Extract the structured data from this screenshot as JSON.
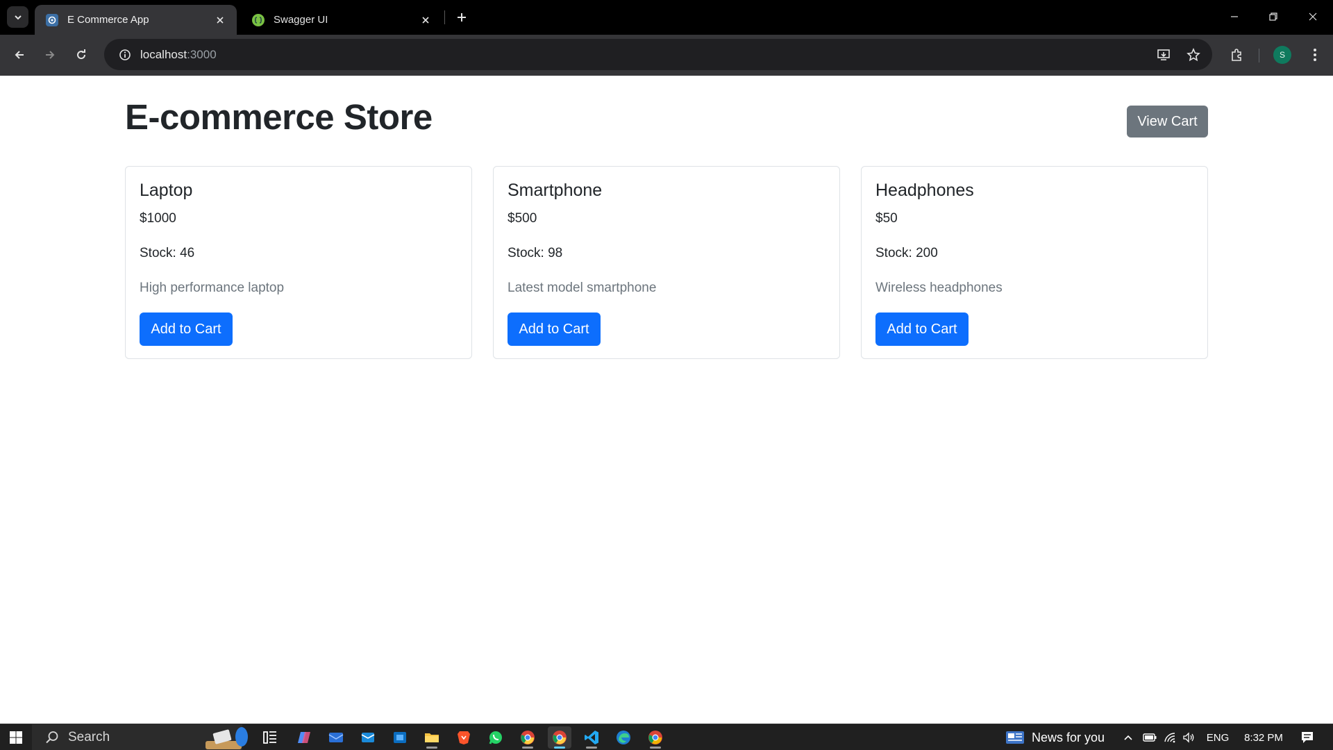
{
  "browser": {
    "tabs": [
      {
        "title": "E Commerce App",
        "active": true
      },
      {
        "title": "Swagger UI",
        "active": false
      }
    ],
    "url_host": "localhost",
    "url_port": ":3000",
    "profile_initial": "S"
  },
  "page": {
    "title": "E-commerce Store",
    "view_cart_label": "View Cart",
    "products": [
      {
        "name": "Laptop",
        "price": "$1000",
        "stock": "Stock: 46",
        "description": "High performance laptop",
        "button": "Add to Cart"
      },
      {
        "name": "Smartphone",
        "price": "$500",
        "stock": "Stock: 98",
        "description": "Latest model smartphone",
        "button": "Add to Cart"
      },
      {
        "name": "Headphones",
        "price": "$50",
        "stock": "Stock: 200",
        "description": "Wireless headphones",
        "button": "Add to Cart"
      }
    ]
  },
  "taskbar": {
    "search_label": "Search",
    "news_label": "News for you",
    "language": "ENG",
    "time": "8:32 PM",
    "apps": [
      "task-view",
      "copilot",
      "mail-app",
      "outlook",
      "store",
      "file-explorer",
      "brave",
      "whatsapp",
      "chrome",
      "chrome-active",
      "vscode",
      "edge",
      "chrome-canary"
    ]
  },
  "colors": {
    "primary": "#0d6efd",
    "secondary": "#6c757d",
    "text": "#212529",
    "browser_chrome": "#353538"
  }
}
